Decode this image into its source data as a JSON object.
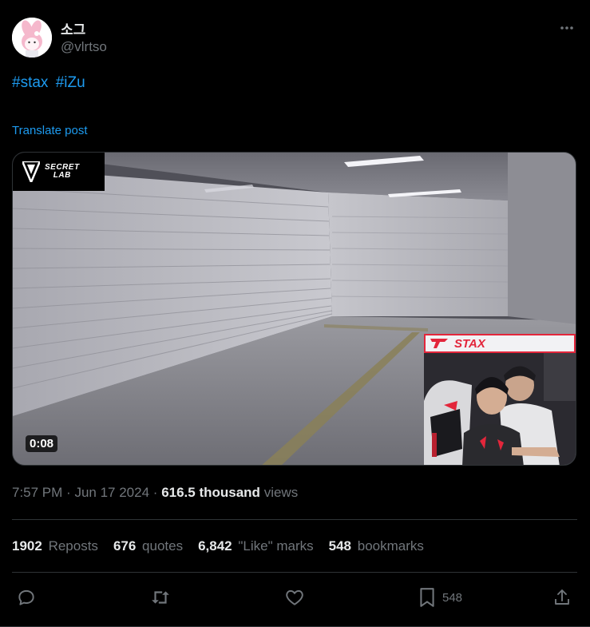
{
  "author": {
    "display_name": "소그",
    "handle": "@vlrtso"
  },
  "post": {
    "hashtags": [
      "#stax",
      "#iZu"
    ],
    "translate_label": "Translate post"
  },
  "media": {
    "duration": "0:08",
    "brand_logo_line1": "SECRET",
    "brand_logo_line2": "LAB",
    "cam_banner_name": "STAX"
  },
  "meta": {
    "time": "7:57 PM",
    "separator": "·",
    "date": "Jun 17 2024",
    "views_count": "616.5 thousand",
    "views_label": "views"
  },
  "stats": {
    "reposts_count": "1902",
    "reposts_label": "Reposts",
    "quotes_count": "676",
    "quotes_label": "quotes",
    "likes_count": "6,842",
    "likes_label": "\"Like\" marks",
    "bookmarks_count": "548",
    "bookmarks_label": "bookmarks"
  },
  "actions": {
    "bookmark_count": "548"
  },
  "colors": {
    "accent": "#1d9bf0",
    "text_primary": "#e7e9ea",
    "text_secondary": "#71767b",
    "divider": "#2f3336",
    "stax_red": "#e3263b"
  },
  "icons": {
    "more": "more-icon",
    "reply": "reply-icon",
    "repost": "repost-icon",
    "like": "heart-icon",
    "bookmark": "bookmark-icon",
    "share": "share-icon"
  }
}
